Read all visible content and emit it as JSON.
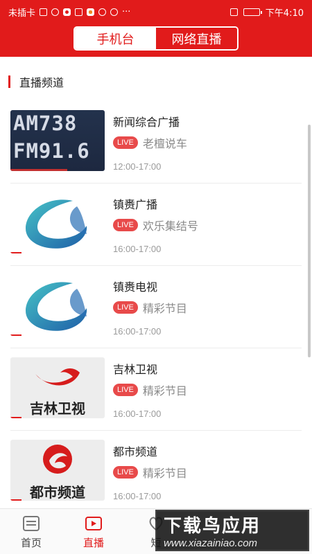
{
  "status_bar": {
    "carrier": "未插卡",
    "time": "下午4:10",
    "dots": "···"
  },
  "tabs": [
    {
      "label": "手机台",
      "active": true
    },
    {
      "label": "网络直播",
      "active": false
    }
  ],
  "section": {
    "title": "直播频道"
  },
  "channels": [
    {
      "name": "新闻综合广播",
      "live": "LIVE",
      "program": "老檀说车",
      "time": "12:00-17:00",
      "thumb_text": [
        "AM738",
        "FM91.6"
      ]
    },
    {
      "name": "镇赉广播",
      "live": "LIVE",
      "program": "欢乐集结号",
      "time": "16:00-17:00"
    },
    {
      "name": "镇赉电视",
      "live": "LIVE",
      "program": "精彩节目",
      "time": "16:00-17:00"
    },
    {
      "name": "吉林卫视",
      "live": "LIVE",
      "program": "精彩节目",
      "time": "16:00-17:00",
      "logo_text": "吉林卫视"
    },
    {
      "name": "都市频道",
      "live": "LIVE",
      "program": "精彩节目",
      "time": "16:00-17:00",
      "logo_text": "都市频道"
    }
  ],
  "bottom_nav": [
    {
      "label": "首页",
      "icon": "home-icon",
      "active": false
    },
    {
      "label": "直播",
      "icon": "live-icon",
      "active": true
    },
    {
      "label": "短",
      "icon": "short-video-icon",
      "active": false
    }
  ],
  "watermark": {
    "title": "下载鸟应用",
    "url": "www.xiazainiao.com"
  },
  "colors": {
    "brand": "#e11b1b",
    "live_badge": "#e84a4a"
  }
}
